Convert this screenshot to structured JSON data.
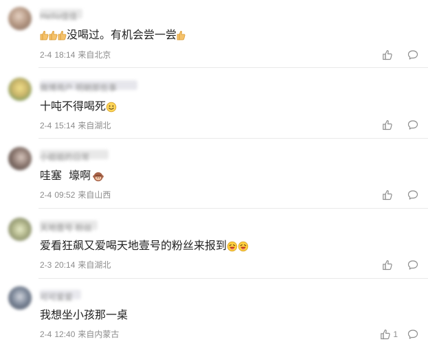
{
  "comments": [
    {
      "username": "Hello佳佳",
      "avatar_color": "#b79a86",
      "text": "没喝过。有机会尝一尝",
      "text_prefix_emoji": "thumbs-up",
      "text_suffix_emoji": "thumbs-up",
      "date": "2-4",
      "time": "18:14",
      "location": "来自北京",
      "likes": ""
    },
    {
      "username": "微博用户 明朝那些事",
      "avatar_color": "#c9b46a",
      "text": "十吨不得喝死",
      "text_suffix_emoji": "smiley",
      "date": "2-4",
      "time": "15:14",
      "location": "来自湖北",
      "likes": ""
    },
    {
      "username": "小姐姐的日常",
      "avatar_color": "#6d5e57",
      "text": "哇塞  壕啊",
      "text_suffix_emoji": "monkey",
      "date": "2-4",
      "time": "09:52",
      "location": "来自山西",
      "likes": ""
    },
    {
      "username": "天地壹号 粉丝",
      "avatar_color": "#9aa07a",
      "text": "爱看狂飙又爱喝天地壹号的粉丝来报到",
      "text_suffix_emoji": "laugh-laugh",
      "date": "2-3",
      "time": "20:14",
      "location": "来自湖北",
      "likes": ""
    },
    {
      "username": "可可爱爱",
      "avatar_color": "#7f8a9b",
      "text": "我想坐小孩那一桌",
      "text_suffix_emoji": "",
      "date": "2-4",
      "time": "12:40",
      "location": "来自内蒙古",
      "likes": "1"
    }
  ]
}
